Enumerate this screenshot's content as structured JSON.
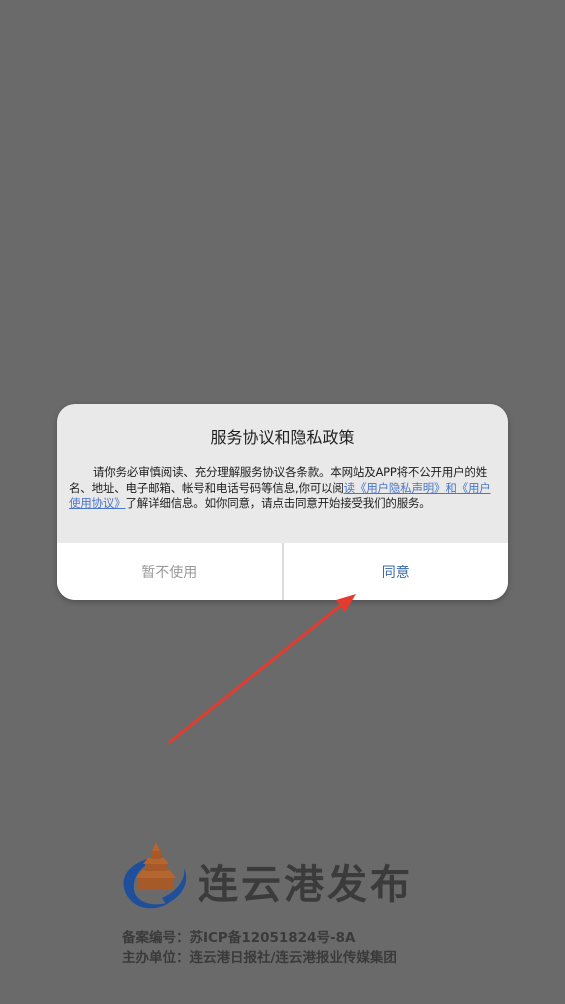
{
  "dialog": {
    "title": "服务协议和隐私政策",
    "body_prefix": "请你务必审慎阅读、充分理解服务协议各条款。本网站及APP将不公开用户的姓名、地址、电子邮箱、帐号和电话号码等信息,你可以阅",
    "link_privacy": "读《用户隐私声明》",
    "link_and": "和",
    "link_terms": "《用户使用协议》",
    "body_suffix": "了解详细信息。如你同意，请点击同意开始接受我们的服务。",
    "cancel_label": "暂不使用",
    "agree_label": "同意"
  },
  "branding": {
    "logo_text": "连云港发布",
    "record_line": "备案编号：苏ICP备12051824号-8A",
    "host_line": "主办单位：连云港日报社/连云港报业传媒集团"
  },
  "colors": {
    "overlay": "#6a6a6a",
    "dialog_bg": "#e9e9e9",
    "link": "#4a76c9",
    "agree": "#3a6aa8",
    "arrow": "#e53a2e"
  }
}
